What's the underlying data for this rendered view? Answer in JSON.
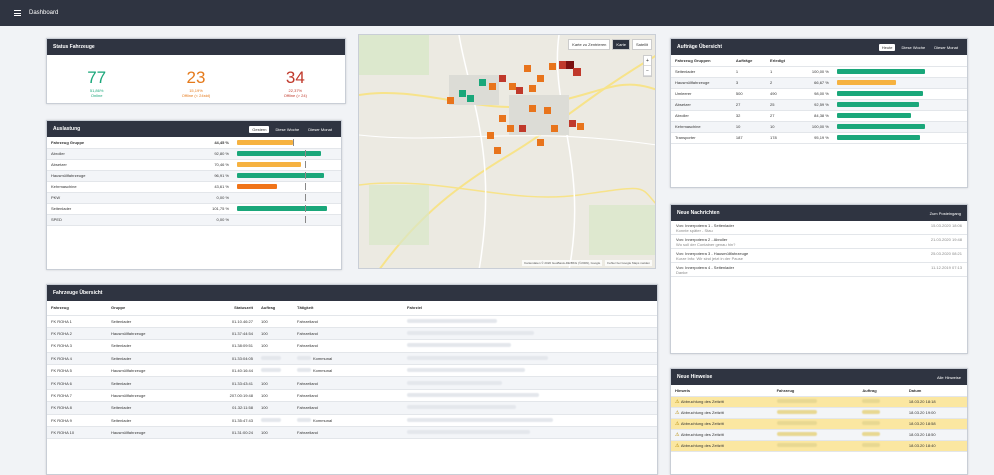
{
  "topbar": {
    "title": "Dashboard",
    "menu_icon": "hamburger-menu-icon"
  },
  "status": {
    "title": "Status Fahrzeuge",
    "items": [
      {
        "value": "77",
        "pct": "51,86%",
        "label": "Online",
        "color": "#1aa77a"
      },
      {
        "value": "23",
        "pct": "15,19%",
        "label": "Offline (< 24std)",
        "color": "#e57a1b"
      },
      {
        "value": "34",
        "pct": "22,37%",
        "label": "Offline (> 24)",
        "color": "#c0392b"
      }
    ]
  },
  "auslastung": {
    "title": "Auslastung",
    "tabs": [
      "Gestern",
      "Diese Woche",
      "Dieser Monat"
    ],
    "active_tab": 0,
    "header": {
      "label": "Fahrzeug Gruppe",
      "value": "44,45 %",
      "fill": 0.62,
      "color": "#f6b240",
      "tick": 0.62
    },
    "rows": [
      {
        "label": "Abroller",
        "value": "92,80 %",
        "fill": 0.93,
        "color": "#1aa77a",
        "tick": 0.75
      },
      {
        "label": "Absetzer",
        "value": "70,46 %",
        "fill": 0.71,
        "color": "#f6b240",
        "tick": 0.75
      },
      {
        "label": "Hausmüllfahrzeuge",
        "value": "96,91 %",
        "fill": 0.97,
        "color": "#1aa77a",
        "tick": 0.75
      },
      {
        "label": "Kehrmaschine",
        "value": "43,61 %",
        "fill": 0.44,
        "color": "#f07419",
        "tick": 0.75
      },
      {
        "label": "PKW",
        "value": "0,00 %",
        "fill": 0.0,
        "color": "#1aa77a",
        "tick": 0.75
      },
      {
        "label": "Seitenlader",
        "value": "101,75 %",
        "fill": 1.0,
        "color": "#1aa77a",
        "tick": 0.75
      },
      {
        "label": "SPED",
        "value": "0,00 %",
        "fill": 0.0,
        "color": "#1aa77a",
        "tick": 0.75
      }
    ]
  },
  "map": {
    "checkbox_label": "Karte zu Zentrieren",
    "btn_karte": "Karte",
    "btn_satellit": "Satellit",
    "zoom_buttons": [
      "+",
      "−"
    ],
    "attribution": "Kartendaten © 2020 GeoBasis-DE/BKG (©2009), Google",
    "attribution_link": "Fehler bei Google Maps melden"
  },
  "auftraege": {
    "title": "Aufträge Übersicht",
    "tabs": [
      "Heute",
      "Diese Woche",
      "Dieser Monat"
    ],
    "active_tab": 0,
    "columns": [
      "Fahrzeug Gruppen",
      "Aufträge",
      "Erledigt",
      ""
    ],
    "rows": [
      {
        "group": "Seitenlader",
        "auftraege": "1",
        "erledigt": "1",
        "pct": "100,00 %",
        "fill": 1.0,
        "color": "#1aa77a"
      },
      {
        "group": "Hausmüllfahrzeuge",
        "auftraege": "3",
        "erledigt": "2",
        "pct": "66,67 %",
        "fill": 0.67,
        "color": "#f6b240"
      },
      {
        "group": "Umleerer",
        "auftraege": "500",
        "erledigt": "490",
        "pct": "98,00 %",
        "fill": 0.98,
        "color": "#1aa77a"
      },
      {
        "group": "Absetzer",
        "auftraege": "27",
        "erledigt": "25",
        "pct": "92,59 %",
        "fill": 0.93,
        "color": "#1aa77a"
      },
      {
        "group": "Abroller",
        "auftraege": "32",
        "erledigt": "27",
        "pct": "84,38 %",
        "fill": 0.84,
        "color": "#1aa77a"
      },
      {
        "group": "Kehrmaschine",
        "auftraege": "10",
        "erledigt": "10",
        "pct": "100,00 %",
        "fill": 1.0,
        "color": "#1aa77a"
      },
      {
        "group": "Transporter",
        "auftraege": "187",
        "erledigt": "178",
        "pct": "95,19 %",
        "fill": 0.95,
        "color": "#1aa77a"
      }
    ]
  },
  "nachrichten": {
    "title": "Neue Nachrichten",
    "link": "Zum Posteingang",
    "items": [
      {
        "title": "Von: Innerpoterra 1 - Seitenlader",
        "body": "Konnte später - Stau",
        "date": "15.03.2020 18:06"
      },
      {
        "title": "Von: Innerpoterra 2 - Abroller",
        "body": "Wo soll der Container genau hin?",
        "date": "21.03.2020 19:48"
      },
      {
        "title": "Von: Innerpoterra 3 - Hausmüllfahrzeuge",
        "body": "Kurze Info: Wir sind jetzt in der Pause",
        "date": "25.03.2020 08:21"
      },
      {
        "title": "Von: Innerpoterra 4 - Seitenlader",
        "body": "Danke",
        "date": "11.12.2019 07:13"
      }
    ]
  },
  "hinweise": {
    "title": "Neue Hinweise",
    "link": "Alle Hinweise",
    "columns": [
      "Hinweis",
      "Fahrzeug",
      "Auftrag",
      "Datum"
    ],
    "rows": [
      {
        "text": "Abbruchlung des Zeitzitt",
        "date": "18.03.20 18:18"
      },
      {
        "text": "Abbruchlung des Zeitzitt",
        "date": "18.03.20 19:00"
      },
      {
        "text": "Abbruchlung des Zeitzitt",
        "date": "18.03.20 18:58"
      },
      {
        "text": "Abbruchlung des Zeitzitt",
        "date": "18.03.20 18:50"
      },
      {
        "text": "Abbruchlung des Zeitzitt",
        "date": "18.03.20 18:40"
      }
    ]
  },
  "fahrzeuge": {
    "title": "Fahrzeuge Übersicht",
    "columns": [
      "Fahrzeug",
      "Gruppe",
      "Statuszeit",
      "Auftrag",
      "Tätigkeit",
      "Fahrziel"
    ],
    "rows": [
      {
        "name": "FK ROHA 1",
        "group": "Seitenlader",
        "time": "01.10.46:27",
        "auftrag": "100",
        "activity": "Fahrzeiland"
      },
      {
        "name": "FK ROHA 2",
        "group": "Hausmüllfahrzeuge",
        "time": "01.37:44:54",
        "auftrag": "100",
        "activity": "Fahrzeiland"
      },
      {
        "name": "FK ROHA 3",
        "group": "Seitenlader",
        "time": "01.38:09:51",
        "auftrag": "100",
        "activity": "Fahrzeiland"
      },
      {
        "name": "FK ROHA 4",
        "group": "Seitenlader",
        "time": "01.33:04:05",
        "auftrag": "",
        "activity": "Kommunal"
      },
      {
        "name": "FK ROHA 5",
        "group": "Hausmüllfahrzeuge",
        "time": "01.40:16:44",
        "auftrag": "",
        "activity": "Kommunal"
      },
      {
        "name": "FK ROHA 6",
        "group": "Seitenlader",
        "time": "01.33:43:41",
        "auftrag": "100",
        "activity": "Fahrzeiland"
      },
      {
        "name": "FK ROHA 7",
        "group": "Hausmüllfahrzeuge",
        "time": "207.00:19:48",
        "auftrag": "100",
        "activity": "Fahrzeiland"
      },
      {
        "name": "FK ROHA 8",
        "group": "Seitenlader",
        "time": "01.32:11:58",
        "auftrag": "100",
        "activity": "Fahrzeiland"
      },
      {
        "name": "FK ROHA 9",
        "group": "Seitenlader",
        "time": "01.35:47:43",
        "auftrag": "",
        "activity": "Kommunal"
      },
      {
        "name": "FK ROHA 10",
        "group": "Hausmüllfahrzeuge",
        "time": "01.31:00:24",
        "auftrag": "100",
        "activity": "Fahrzeiland"
      }
    ]
  }
}
